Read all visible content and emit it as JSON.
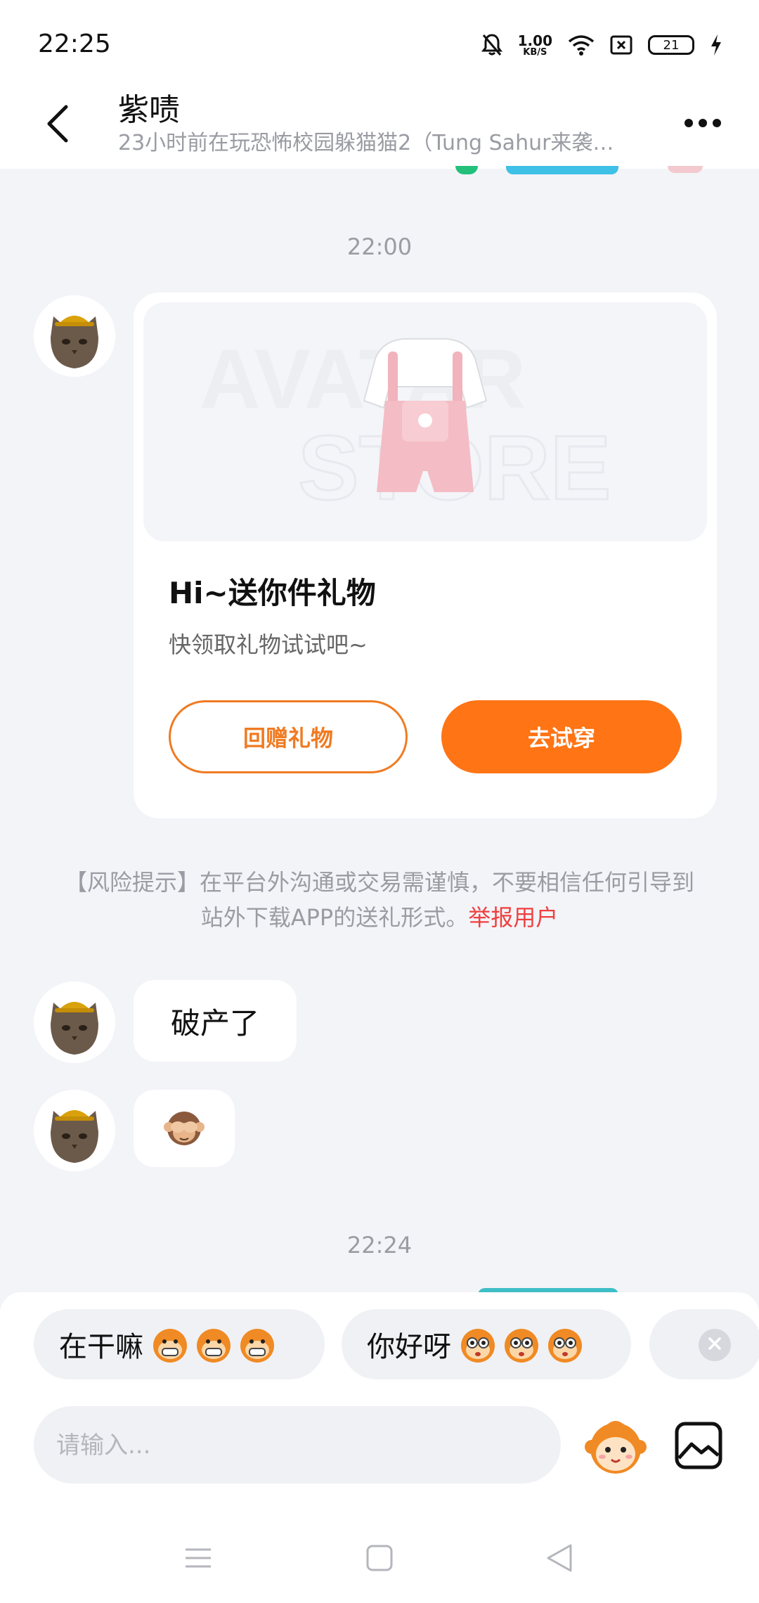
{
  "status_bar": {
    "time": "22:25",
    "net_speed_value": "1.00",
    "net_speed_unit": "KB/S",
    "battery_level": "21",
    "icons": [
      "mute-bell-icon",
      "wifi-icon",
      "sim-icon",
      "battery-icon",
      "charging-icon"
    ]
  },
  "header": {
    "title": "紫啧",
    "subtitle": "23小时前在玩恐怖校园躲猫猫2（Tung Sahur来袭…",
    "back_icon": "back-arrow-icon",
    "more_icon": "more-icon"
  },
  "chat": {
    "timestamp_1": "22:00",
    "gift_card": {
      "image_watermark_1": "AVATAR",
      "image_watermark_2": "STORE",
      "title": "Hi~送你件礼物",
      "description": "快领取礼物试试吧~",
      "return_button": "回赠礼物",
      "try_button": "去试穿"
    },
    "risk_notice": {
      "text": "【风险提示】在平台外沟通或交易需谨慎，不要相信任何引导到站外下载APP的送礼形式。",
      "link": "举报用户"
    },
    "message_1": "破产了",
    "message_2_emoji": "🙈",
    "timestamp_2": "22:24"
  },
  "quick_replies": [
    {
      "text": "在干嘛",
      "emoji": "grinning-monkey-emoji"
    },
    {
      "text": "你好呀",
      "emoji": "wide-eyed-monkey-emoji"
    }
  ],
  "composer": {
    "placeholder": "请输入...",
    "emoji_button_icon": "monkey-face-icon",
    "image_button_icon": "image-icon"
  },
  "nav_bar": [
    "menu-icon",
    "home-icon",
    "back-triangle-icon"
  ],
  "colors": {
    "accent": "#ff7414",
    "risk_link": "#ef3f3f",
    "background": "#f3f4f8"
  }
}
